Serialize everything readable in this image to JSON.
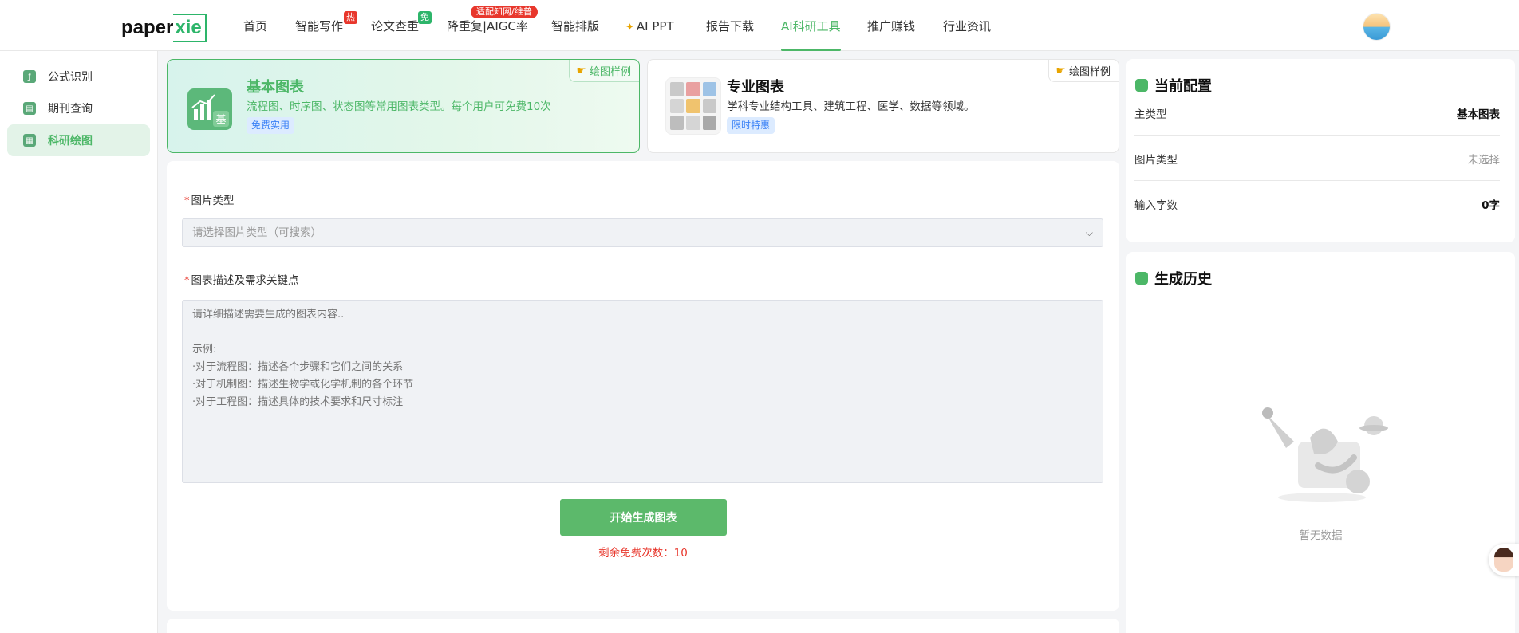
{
  "header": {
    "logo": {
      "text_main": "paper",
      "text_accent": "xie"
    },
    "nav": [
      {
        "label": "首页",
        "badge": null
      },
      {
        "label": "智能写作",
        "badge": "热",
        "badge_color": "#e8372c"
      },
      {
        "label": "论文查重",
        "badge": "免",
        "badge_color": "#2db56a"
      },
      {
        "label": "降重复|AIGC率",
        "badge": "适配知网/维普",
        "badge_color": "#e8372c"
      },
      {
        "label": "智能排版",
        "badge": null
      },
      {
        "label": "AI PPT",
        "badge": null,
        "icon": "magic-wand-icon"
      },
      {
        "label": "报告下载",
        "badge": null
      },
      {
        "label": "AI科研工具",
        "badge": null,
        "active": true
      },
      {
        "label": "推广赚钱",
        "badge": null
      },
      {
        "label": "行业资讯",
        "badge": null
      }
    ]
  },
  "sidebar": {
    "items": [
      {
        "label": "公式识别",
        "icon": "formula-icon"
      },
      {
        "label": "期刊查询",
        "icon": "journal-icon"
      },
      {
        "label": "科研绘图",
        "icon": "chart-draw-icon",
        "active": true
      }
    ]
  },
  "chart_types": {
    "basic": {
      "title": "基本图表",
      "desc": "流程图、时序图、状态图等常用图表类型。每个用户可免费10次",
      "tag": "免费实用",
      "sample": "绘图样例",
      "icon_char": "基"
    },
    "pro": {
      "title": "专业图表",
      "desc": "学科专业结构工具、建筑工程、医学、数据等领域。",
      "tag": "限时特惠",
      "sample": "绘图样例"
    }
  },
  "form": {
    "required_mark": "*",
    "image_type_label": "图片类型",
    "image_type_placeholder": "请选择图片类型（可搜索）",
    "desc_label": "图表描述及需求关键点",
    "desc_placeholder": "请详细描述需要生成的图表内容..\n\n示例:\n·对于流程图：描述各个步骤和它们之间的关系\n·对于机制图：描述生物学或化学机制的各个环节\n·对于工程图：描述具体的技术要求和尺寸标注",
    "generate_label": "开始生成图表",
    "remain_text": "剩余免费次数：10"
  },
  "config": {
    "title": "当前配置",
    "rows": [
      {
        "label": "主类型",
        "value": "基本图表"
      },
      {
        "label": "图片类型",
        "value": "未选择"
      },
      {
        "label": "输入字数",
        "value": "0字"
      }
    ]
  },
  "history": {
    "title": "生成历史",
    "empty_text": "暂无数据"
  },
  "colors": {
    "accent": "#4cb767",
    "danger": "#e8372c",
    "tag_blue": "#3b82f6"
  }
}
